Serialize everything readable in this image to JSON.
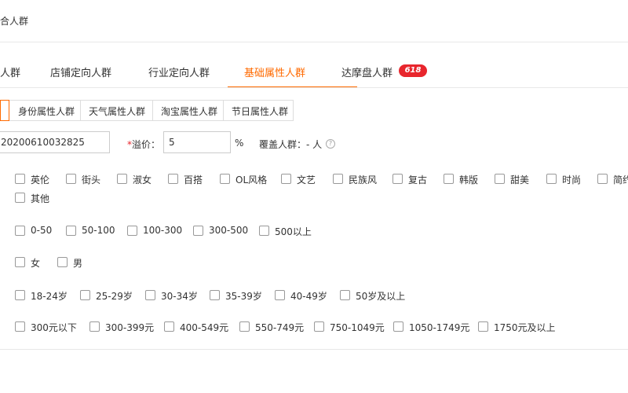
{
  "page": {
    "title": "合人群"
  },
  "tabs": [
    {
      "label": "人群"
    },
    {
      "label": "店铺定向人群"
    },
    {
      "label": "行业定向人群"
    },
    {
      "label": "基础属性人群",
      "active": true
    },
    {
      "label": "达摩盘人群",
      "badge": "618"
    }
  ],
  "subtabs": {
    "first_label": "",
    "items": [
      "身份属性人群",
      "天气属性人群",
      "淘宝属性人群",
      "节日属性人群"
    ]
  },
  "form": {
    "name_value": "20200610032825",
    "price_label": "溢价：",
    "price_required_mark": "*",
    "price_value": "5",
    "price_unit": "%",
    "coverage_label": "覆盖人群：",
    "coverage_value": "- 人"
  },
  "groups": [
    {
      "key": "style",
      "options": [
        "英伦",
        "街头",
        "淑女",
        "百搭",
        "OL风格",
        "文艺",
        "民族风",
        "复古",
        "韩版",
        "甜美",
        "时尚",
        "简约",
        "其他"
      ]
    },
    {
      "key": "price_range",
      "options": [
        "0-50",
        "50-100",
        "100-300",
        "300-500",
        "500以上"
      ]
    },
    {
      "key": "gender",
      "options": [
        "女",
        "男"
      ]
    },
    {
      "key": "age",
      "options": [
        "18-24岁",
        "25-29岁",
        "30-34岁",
        "35-39岁",
        "40-49岁",
        "50岁及以上"
      ]
    },
    {
      "key": "spend",
      "options": [
        "300元以下",
        "300-399元",
        "400-549元",
        "550-749元",
        "750-1049元",
        "1050-1749元",
        "1750元及以上"
      ]
    }
  ],
  "colors": {
    "accent": "#ff6a00",
    "badge": "#e8262d",
    "border": "#dddddd",
    "text": "#333333"
  }
}
